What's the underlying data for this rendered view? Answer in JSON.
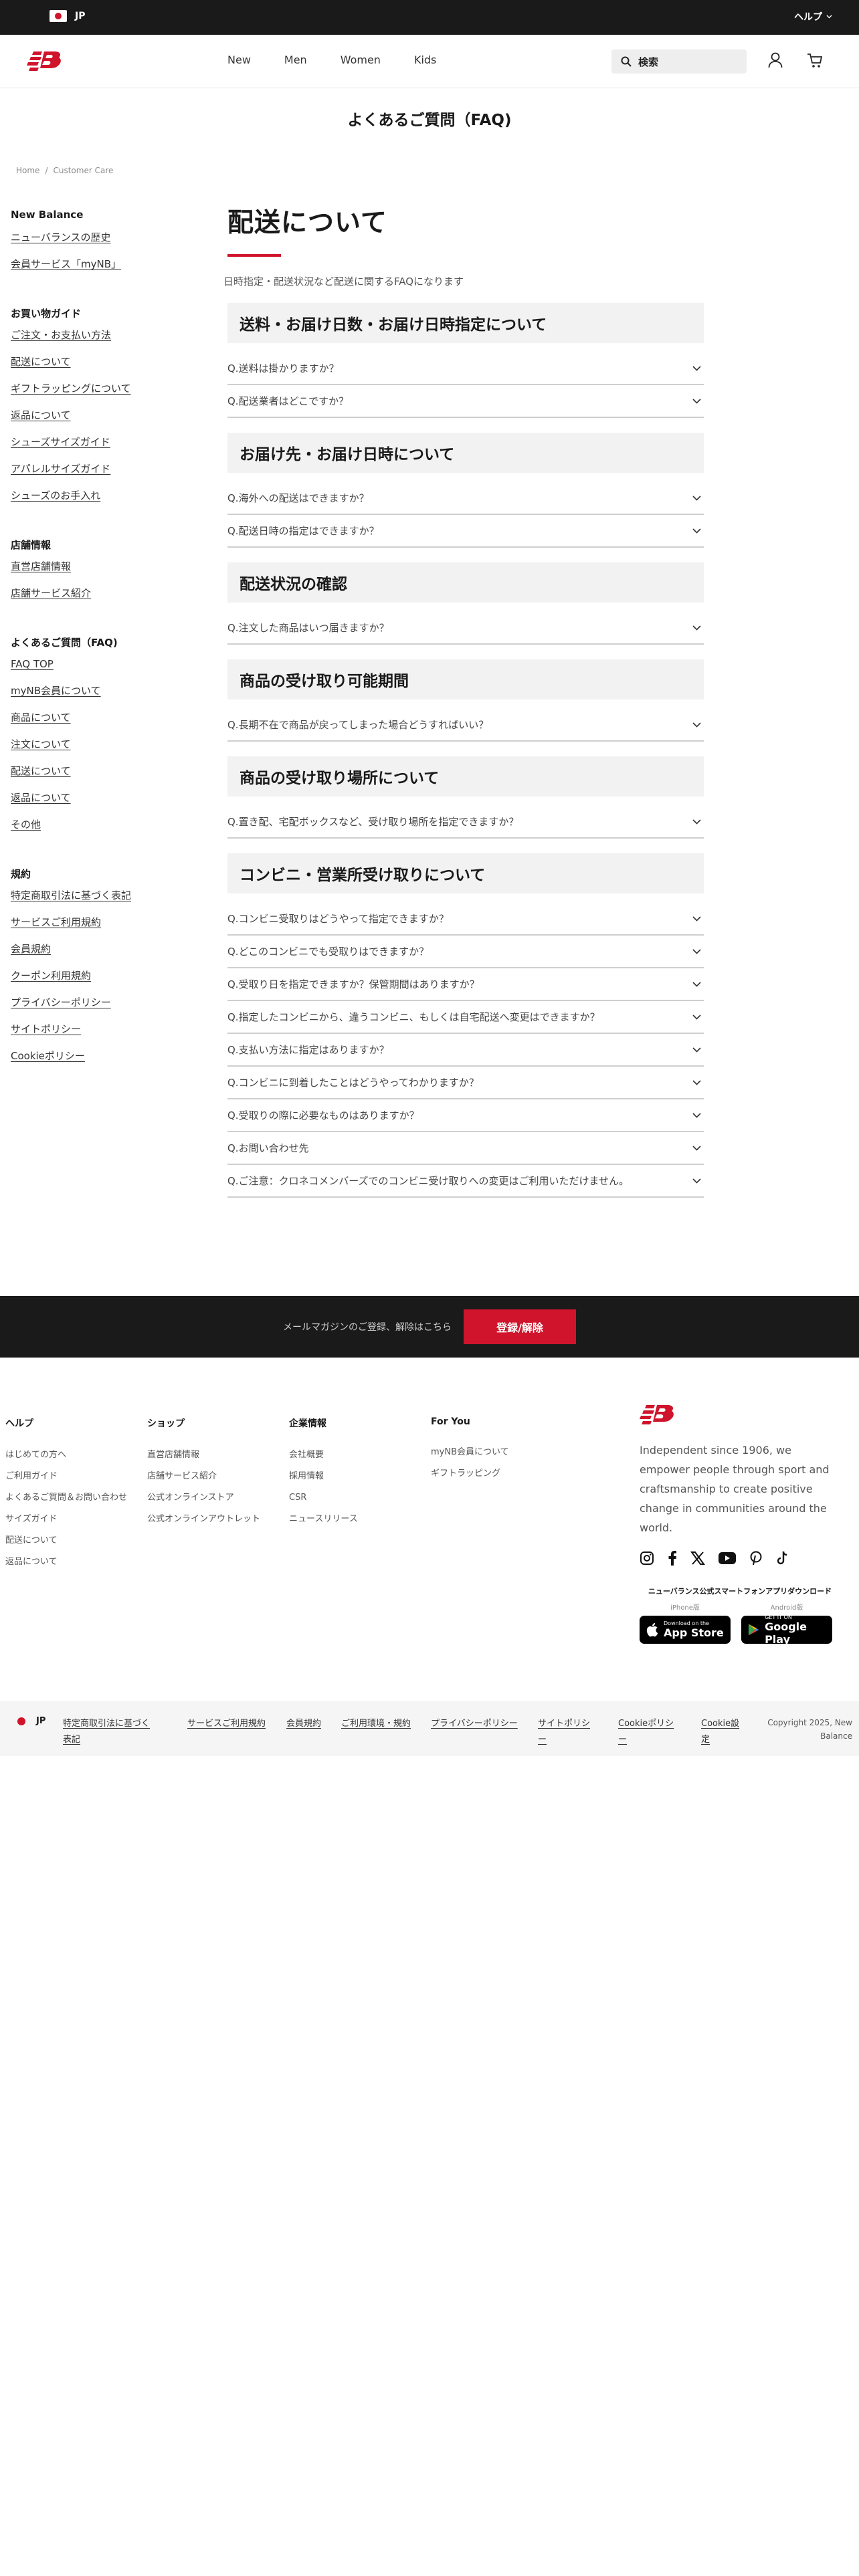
{
  "topbar": {
    "region": "JP",
    "help": "ヘルプ"
  },
  "header": {
    "nav": [
      "New",
      "Men",
      "Women",
      "Kids"
    ],
    "search_placeholder": "検索"
  },
  "page_title": "よくあるご質問（FAQ)",
  "breadcrumb": [
    "Home",
    "/",
    "Customer Care"
  ],
  "sidebar": [
    {
      "heading": "New Balance",
      "links": [
        "ニューバランスの歴史",
        "会員サービス「myNB」"
      ]
    },
    {
      "heading": "お買い物ガイド",
      "links": [
        "ご注文・お支払い方法",
        "配送について",
        "ギフトラッピングについて",
        "返品について",
        "シューズサイズガイド",
        "アパレルサイズガイド",
        "シューズのお手入れ"
      ]
    },
    {
      "heading": "店舗情報",
      "links": [
        "直営店舗情報",
        "店舗サービス紹介"
      ]
    },
    {
      "heading": "よくあるご質問（FAQ)",
      "links": [
        "FAQ TOP",
        "myNB会員について",
        "商品について",
        "注文について",
        "配送について",
        "返品について",
        "その他"
      ]
    },
    {
      "heading": "規約",
      "links": [
        "特定商取引法に基づく表記",
        "サービスご利用規約",
        "会員規約",
        "クーポン利用規約",
        "プライバシーポリシー",
        "サイトポリシー",
        "Cookieポリシー"
      ]
    }
  ],
  "main": {
    "title": "配送について",
    "intro": "日時指定・配送状況など配送に関するFAQになります",
    "sections": [
      {
        "heading": "送料・お届け日数・お届け日時指定について",
        "questions": [
          "Q.送料は掛かりますか？",
          "Q.配送業者はどこですか？"
        ]
      },
      {
        "heading": "お届け先・お届け日時について",
        "questions": [
          "Q.海外への配送はできますか？",
          "Q.配送日時の指定はできますか？"
        ]
      },
      {
        "heading": "配送状況の確認",
        "questions": [
          "Q.注文した商品はいつ届きますか？"
        ]
      },
      {
        "heading": "商品の受け取り可能期間",
        "questions": [
          "Q.長期不在で商品が戻ってしまった場合どうすればいい？"
        ]
      },
      {
        "heading": "商品の受け取り場所について",
        "questions": [
          "Q.置き配、宅配ボックスなど、受け取り場所を指定できますか？"
        ]
      },
      {
        "heading": "コンビニ・営業所受け取りについて",
        "questions": [
          "Q.コンビニ受取りはどうやって指定できますか？",
          "Q.どこのコンビニでも受取りはできますか？",
          "Q.受取り日を指定できますか？保管期間はありますか？",
          "Q.指定したコンビニから、違うコンビニ、もしくは自宅配送へ変更はできますか？",
          "Q.支払い方法に指定はありますか？",
          "Q.コンビニに到着したことはどうやってわかりますか？",
          "Q.受取りの際に必要なものはありますか？",
          "Q.お問い合わせ先",
          "Q.ご注意：クロネコメンバーズでのコンビニ受け取りへの変更はご利用いただけません。"
        ]
      }
    ]
  },
  "newsletter": {
    "text": "メールマガジンのご登録、解除はこちら",
    "button": "登録/解除"
  },
  "footer": {
    "columns": [
      {
        "heading": "ヘルプ",
        "links": [
          "はじめての方へ",
          "ご利用ガイド",
          "よくあるご質問＆お問い合わせ",
          "サイズガイド",
          "配送について",
          "返品について"
        ]
      },
      {
        "heading": "ショップ",
        "links": [
          "直営店舗情報",
          "店舗サービス紹介",
          "公式オンラインストア",
          "公式オンラインアウトレット"
        ]
      },
      {
        "heading": "企業情報",
        "links": [
          "会社概要",
          "採用情報",
          "CSR",
          "ニュースリリース"
        ]
      },
      {
        "heading": "For You",
        "links": [
          "myNB会員について",
          "ギフトラッピング"
        ]
      }
    ],
    "brand_text": "Independent since 1906, we empower people through sport and craftsmanship to create positive change in communities around the world.",
    "app_heading": "ニューバランス公式スマートフォンアプリダウンロード",
    "app_iphone": "iPhone版",
    "app_android": "Android版",
    "app_store": {
      "small": "Download on the",
      "big": "App Store"
    },
    "google_play": {
      "small": "GET IT ON",
      "big": "Google Play"
    }
  },
  "bottom": {
    "region": "JP",
    "links": [
      "特定商取引法に基づく表記",
      "サービスご利用規約",
      "会員規約",
      "ご利用環境・規約",
      "プライバシーポリシー",
      "サイトポリシー",
      "Cookieポリシー",
      "Cookie設定"
    ],
    "copyright": "Copyright 2025, New Balance"
  },
  "colors": {
    "brand_red": "#cf142b",
    "dark": "#1a1a1a"
  }
}
